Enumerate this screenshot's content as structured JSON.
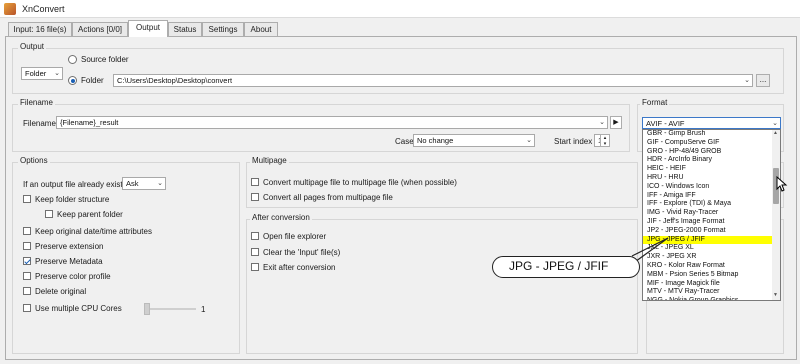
{
  "window": {
    "title": "XnConvert"
  },
  "tabs": [
    {
      "label": "Input: 16 file(s)"
    },
    {
      "label": "Actions [0/0]"
    },
    {
      "label": "Output"
    },
    {
      "label": "Status"
    },
    {
      "label": "Settings"
    },
    {
      "label": "About"
    }
  ],
  "output": {
    "group_label": "Output",
    "mode_select": "Folder",
    "source_folder_label": "Source folder",
    "folder_label": "Folder",
    "folder_path": "C:\\Users\\Desktop\\Desktop\\convert",
    "browse_label": "..."
  },
  "filename": {
    "group_label": "Filename",
    "field_label": "Filename",
    "value": "{Filename}_result",
    "case_label": "Case",
    "case_value": "No change",
    "start_index_label": "Start index",
    "start_index_value": "1"
  },
  "format": {
    "group_label": "Format",
    "selected": "AVIF - AVIF",
    "items": [
      "GBR - Gimp Brush",
      "GIF - CompuServe GIF",
      "GRO - HP-48/49 GROB",
      "HDR - ArcInfo Binary",
      "HEIC - HEIF",
      "HRU - HRU",
      "ICO - Windows Icon",
      "IFF - Amiga IFF",
      "IFF - Explore (TDI) & Maya",
      "IMG - Vivid Ray-Tracer",
      "JIF - Jeff's Image Format",
      "JP2 - JPEG-2000 Format",
      "JPG - JPEG / JFIF",
      "JXL - JPEG XL",
      "JXR - JPEG XR",
      "KRO - Kolor Raw Format",
      "MBM - Psion Series 5 Bitmap",
      "MIF - Image Magick file",
      "MTV - MTV Ray-Tracer",
      "NGG - Nokia Group Graphics"
    ],
    "callout": "JPG - JPEG / JFIF"
  },
  "options": {
    "group_label": "Options",
    "exists_label": "If an output file already exists",
    "exists_value": "Ask",
    "keep_folder": "Keep folder structure",
    "keep_parent": "Keep parent folder",
    "keep_date": "Keep original date/time attributes",
    "preserve_ext": "Preserve extension",
    "preserve_meta": "Preserve Metadata",
    "preserve_color": "Preserve color profile",
    "delete_original": "Delete original",
    "multi_cpu": "Use multiple CPU Cores",
    "cpu_value": "1"
  },
  "multipage": {
    "group_label": "Multipage",
    "convert_multi": "Convert multipage file to multipage file (when possible)",
    "convert_all": "Convert all pages from multipage file"
  },
  "after": {
    "group_label": "After conversion",
    "open_explorer": "Open file explorer",
    "clear_input": "Clear the 'Input' file(s)",
    "exit_after": "Exit after conversion"
  }
}
